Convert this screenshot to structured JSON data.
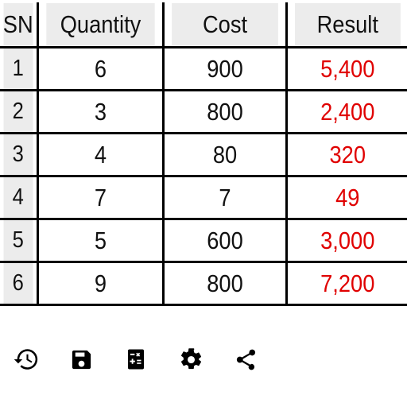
{
  "app": {
    "type": "mobile-calculator-result-table",
    "background_color": "#ffffff"
  },
  "table": {
    "name": "calculation-results-table",
    "header_background": "#ececec",
    "grid_color": "#000000",
    "result_color": "#e00000",
    "text_color": "#111111",
    "columns": [
      {
        "key": "sn",
        "label": "SN"
      },
      {
        "key": "quantity",
        "label": "Quantity"
      },
      {
        "key": "cost",
        "label": "Cost"
      },
      {
        "key": "result",
        "label": "Result"
      }
    ],
    "rows": [
      {
        "sn": "1",
        "quantity": "6",
        "cost": "900",
        "result": "5,400"
      },
      {
        "sn": "2",
        "quantity": "3",
        "cost": "800",
        "result": "2,400"
      },
      {
        "sn": "3",
        "quantity": "4",
        "cost": "80",
        "result": "320"
      },
      {
        "sn": "4",
        "quantity": "7",
        "cost": "7",
        "result": "49"
      },
      {
        "sn": "5",
        "quantity": "5",
        "cost": "600",
        "result": "3,000"
      },
      {
        "sn": "6",
        "quantity": "9",
        "cost": "800",
        "result": "7,200"
      }
    ]
  },
  "toolbar": {
    "name": "bottom-action-bar",
    "icon_color": "#000000",
    "items": [
      {
        "icon": "history-icon",
        "label": "History"
      },
      {
        "icon": "save-icon",
        "label": "Save"
      },
      {
        "icon": "calculator-icon",
        "label": "Calculator"
      },
      {
        "icon": "settings-icon",
        "label": "Settings"
      },
      {
        "icon": "share-icon",
        "label": "Share"
      }
    ]
  }
}
